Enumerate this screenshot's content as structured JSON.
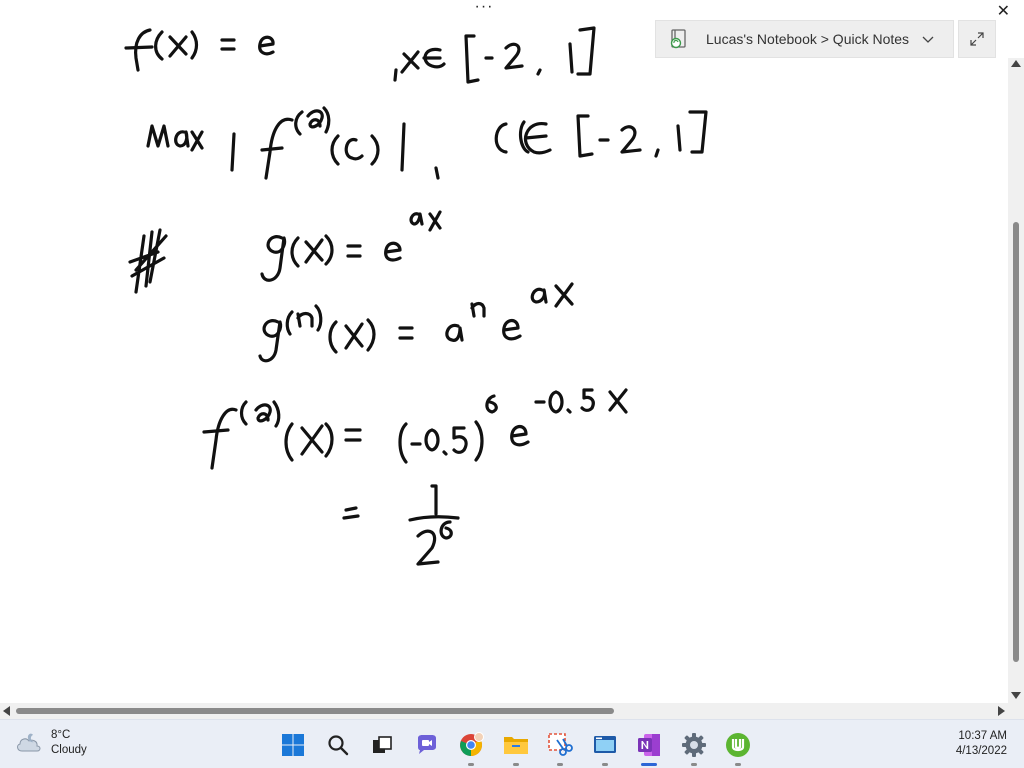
{
  "window": {
    "menu_dots": "···",
    "close_glyph": "✕"
  },
  "breadcrumb": {
    "text": "Lucas's Notebook > Quick Notes",
    "icon": "notebook-sync-icon",
    "dropdown_icon": "chevron-down-icon"
  },
  "expand": {
    "icon": "expand-diagonal-icon"
  },
  "taskbar": {
    "weather": {
      "temp": "8°C",
      "condition": "Cloudy",
      "icon": "cloud-moon-icon"
    },
    "apps": [
      {
        "name": "start",
        "icon": "windows-start-icon"
      },
      {
        "name": "search",
        "icon": "search-icon"
      },
      {
        "name": "task-view",
        "icon": "task-view-icon"
      },
      {
        "name": "chat",
        "icon": "chat-icon"
      },
      {
        "name": "chrome",
        "icon": "chrome-icon"
      },
      {
        "name": "file-explorer",
        "icon": "folder-icon"
      },
      {
        "name": "snipping-tool",
        "icon": "snipping-tool-icon"
      },
      {
        "name": "app-window",
        "icon": "app-window-icon"
      },
      {
        "name": "onenote",
        "icon": "onenote-icon"
      },
      {
        "name": "settings",
        "icon": "gear-icon"
      },
      {
        "name": "utorrent",
        "icon": "utorrent-icon"
      }
    ],
    "clock": {
      "time": "10:37 AM",
      "date": "4/13/2022"
    }
  },
  "colors": {
    "taskbar_bg": "#eaeef6",
    "onenote": "#7b33b7",
    "accent": "#2c66d6"
  }
}
